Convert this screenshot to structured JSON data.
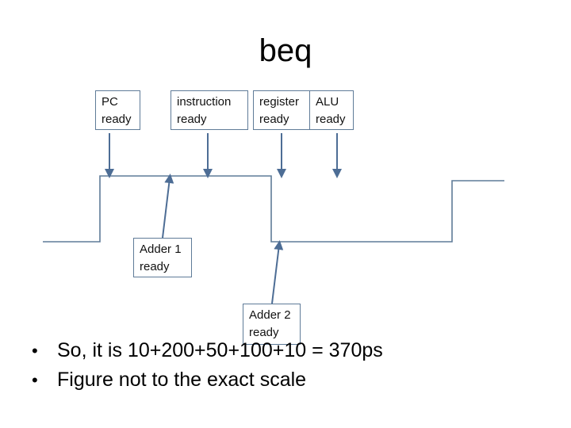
{
  "slide": {
    "title": "beq"
  },
  "labels": {
    "pc": [
      "PC",
      "ready"
    ],
    "instruction": [
      "instruction",
      "ready"
    ],
    "register": [
      "register",
      "ready"
    ],
    "alu": [
      "ALU",
      "ready"
    ],
    "adder1": [
      "Adder 1",
      "ready"
    ],
    "adder2": [
      "Adder 2",
      "ready"
    ]
  },
  "bullets": [
    "So, it is 10+200+50+100+10 = 370ps",
    "Figure not to the exact scale"
  ],
  "colors": {
    "waveform": "#5f7b98",
    "arrow": "#4d6d95",
    "box_border": "#5f7b98"
  }
}
